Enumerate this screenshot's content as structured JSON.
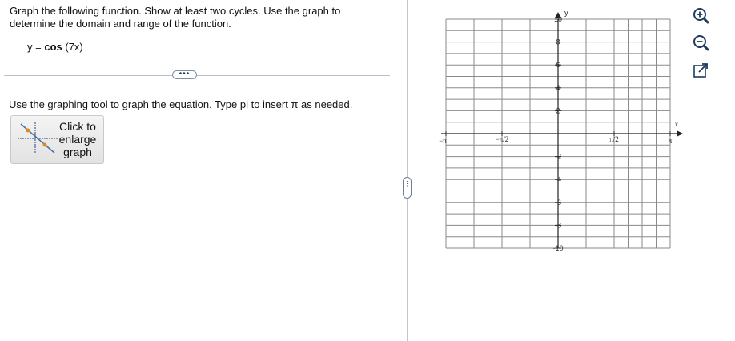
{
  "question": {
    "prompt": "Graph the following function. Show at least two cycles. Use the graph to determine the domain and range of the function.",
    "equation_lhs": "y =",
    "equation_fn": "cos",
    "equation_arg": "(7x)",
    "expand_label": "•••"
  },
  "instruction": "Use the graphing tool to graph the equation. Type pi to insert π as needed.",
  "enlarge_button": {
    "line1": "Click to",
    "line2": "enlarge",
    "line3": "graph"
  },
  "splitter_label": "⋮",
  "graph": {
    "x_axis_label": "x",
    "y_axis_label": "y",
    "x_range": [
      -3.14159,
      3.14159
    ],
    "y_range": [
      -10,
      10
    ],
    "x_ticks": [
      {
        "value": -3.14159,
        "label": "−π"
      },
      {
        "value": -1.5708,
        "label": "−π/2"
      },
      {
        "value": 1.5708,
        "label": "π/2"
      },
      {
        "value": 3.14159,
        "label": "π"
      }
    ],
    "y_ticks": [
      {
        "value": 10,
        "label": "10"
      },
      {
        "value": 8,
        "label": "8"
      },
      {
        "value": 6,
        "label": "6"
      },
      {
        "value": 4,
        "label": "4"
      },
      {
        "value": 2,
        "label": "2"
      },
      {
        "value": -2,
        "label": "-2"
      },
      {
        "value": -4,
        "label": "-4"
      },
      {
        "value": -6,
        "label": "-6"
      },
      {
        "value": -8,
        "label": "-8"
      },
      {
        "value": -10,
        "label": "-10"
      }
    ],
    "grid": true
  },
  "tools": {
    "zoom_in": "zoom-in-icon",
    "zoom_out": "zoom-out-icon",
    "popout": "popout-icon"
  },
  "colors": {
    "accent": "#1f3b5c",
    "grid": "#8a8a8a",
    "point": "#e08a1e"
  }
}
